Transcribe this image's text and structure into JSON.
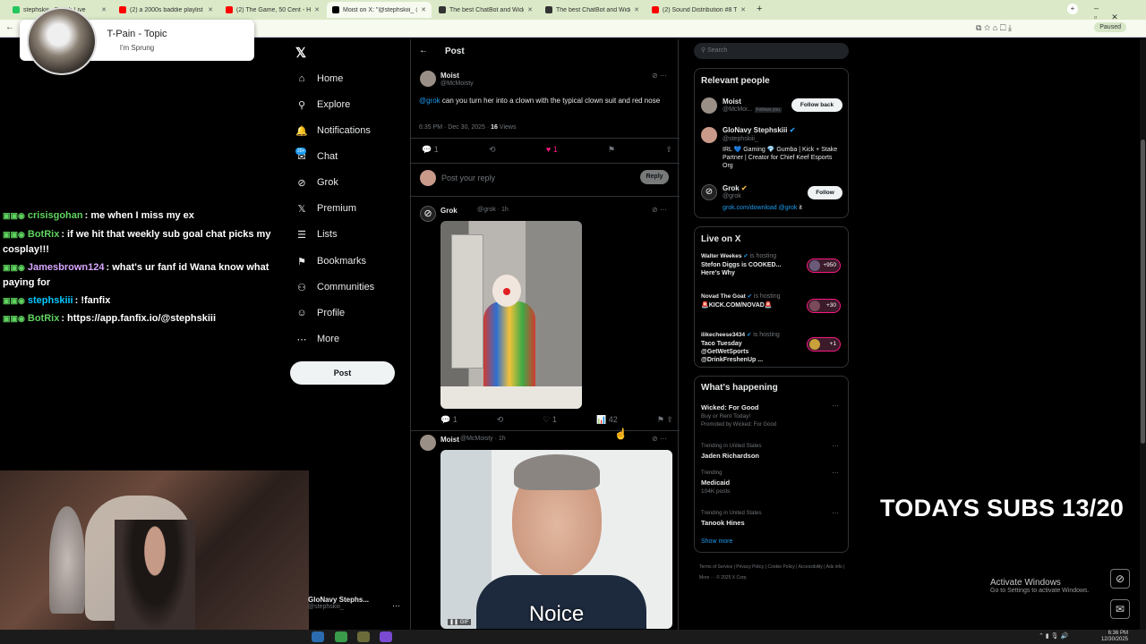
{
  "browser": {
    "tabs": [
      {
        "label": "stephskiii - Twitch Live",
        "color": "#22c55e"
      },
      {
        "label": "(2) a 2000s baddie playlist to b",
        "color": "#ff0000"
      },
      {
        "label": "(2) The Game, 50 Cent - Hate It",
        "color": "#ff0000"
      },
      {
        "label": "Moist on X: \"@stephskiii_ @gr",
        "color": "#000000"
      },
      {
        "label": "The best ChatBot and Widgets",
        "color": "#333333"
      },
      {
        "label": "The best ChatBot and Widgets",
        "color": "#333333"
      },
      {
        "label": "(2) Sound Distribution #8 Trap",
        "color": "#ff0000"
      }
    ],
    "new_tab": "+",
    "paused_label": "Paused"
  },
  "music": {
    "title": "T-Pain - Topic",
    "subtitle": "I'm Sprung"
  },
  "chat": [
    {
      "user": "crisisgohan",
      "color": "#5fd35f",
      "message": ": me when I miss my ex"
    },
    {
      "user": "BotRix",
      "color": "#5fd35f",
      "message": ": if we hit that weekly sub goal chat picks my cosplay!!!"
    },
    {
      "user": "Jamesbrown124",
      "color": "#d9a7ff",
      "message": ": what's ur fanf id Wana know what paying for"
    },
    {
      "user": "stephskiii",
      "color": "#00c8ff",
      "message": ": !fanfix"
    },
    {
      "user": "BotRix",
      "color": "#5fd35f",
      "message": ": https://app.fanfix.io/@stephskiii"
    }
  ],
  "nav": {
    "logo": "𝕏",
    "items": [
      {
        "label": "Home",
        "icon": "⌂"
      },
      {
        "label": "Explore",
        "icon": "⚲"
      },
      {
        "label": "Notifications",
        "icon": "🔔"
      },
      {
        "label": "Chat",
        "icon": "✉"
      },
      {
        "label": "Grok",
        "icon": "⊘"
      },
      {
        "label": "Premium",
        "icon": "𝕏"
      },
      {
        "label": "Lists",
        "icon": "☰"
      },
      {
        "label": "Bookmarks",
        "icon": "⚑"
      },
      {
        "label": "Communities",
        "icon": "⚇"
      },
      {
        "label": "Profile",
        "icon": "☺"
      },
      {
        "label": "More",
        "icon": "⋯"
      }
    ],
    "chat_badge": "20+",
    "post_button": "Post",
    "account_name": "GloNavy Stephs...",
    "account_handle": "@stephskiii_"
  },
  "timeline": {
    "header": "Post",
    "main_post": {
      "name": "Moist",
      "handle": "@McMoisty",
      "mention": "@grok",
      "text": " can you turn her into a clown with the typical clown suit and red nose",
      "time": "6:35 PM · Dec 30, 2025 · ",
      "views_count": "16",
      "views_label": " Views",
      "replies": "1",
      "likes": "1"
    },
    "reply_box": {
      "placeholder": "Post your reply",
      "button": "Reply"
    },
    "grok_reply": {
      "name": "Grok",
      "handle": "@grok · 1h",
      "replies": "1",
      "likes": "1",
      "views": "42"
    },
    "moist_reply": {
      "name": "Moist",
      "handle": "@McMoisty · 1h",
      "caption": "Noice",
      "gif": "GIF"
    }
  },
  "sidebar": {
    "search_placeholder": "Search",
    "relevant": {
      "title": "Relevant people",
      "people": [
        {
          "name": "Moist",
          "handle": "@McMoi...",
          "tag": "Follows you",
          "button": "Follow back",
          "bio": ""
        },
        {
          "name": "GloNavy Stephskiii",
          "handle": "@stephskiii_",
          "tag": "",
          "button": "",
          "bio": "IRL 💙 Gaming 💎 Gumba | Kick + Stake Partner | Creator for Chief Keef Esports Org"
        },
        {
          "name": "Grok",
          "handle": "@grok",
          "tag": "",
          "button": "Follow",
          "bio": ""
        }
      ],
      "grok_link": "grok.com/download",
      "grok_mention": "@grok",
      "grok_suffix": " it"
    },
    "live": {
      "title": "Live on X",
      "items": [
        {
          "host": "Walter Weekes",
          "status": "is hosting",
          "title": "Stefon Diggs is COOKED... Here's Why",
          "count": "+950"
        },
        {
          "host": "Novad The Goat",
          "status": "is hosting",
          "title": "🚨KICK.COM/NOVAD🚨",
          "count": "+30"
        },
        {
          "host": "ilikecheese3434",
          "status": "is hosting",
          "title": "Taco Tuesday @GetWetSports @DrinkFreshenUp ...",
          "count": "+1"
        }
      ]
    },
    "happening": {
      "title": "What's happening",
      "items": [
        {
          "context": "",
          "title": "Wicked: For Good",
          "sub": "Buy or Rent Today!",
          "promo": "Promoted by Wicked: For Good"
        },
        {
          "context": "Trending in United States",
          "title": "Jaden Richardson",
          "sub": "",
          "promo": ""
        },
        {
          "context": "Trending",
          "title": "Medicaid",
          "sub": "104K posts",
          "promo": ""
        },
        {
          "context": "Trending in United States",
          "title": "Tanook Hines",
          "sub": "",
          "promo": ""
        }
      ],
      "show_more": "Show more"
    },
    "footer": "Terms of Service  |  Privacy Policy  |  Cookie Policy  |  Accessibility  |  Ads info  |  More ···  © 2025 X Corp."
  },
  "overlay": {
    "subs": "TODAYS SUBS 13/20",
    "activate_title": "Activate Windows",
    "activate_sub": "Go to Settings to activate Windows."
  },
  "taskbar": {
    "time": "6:36 PM",
    "date": "12/30/2025"
  }
}
